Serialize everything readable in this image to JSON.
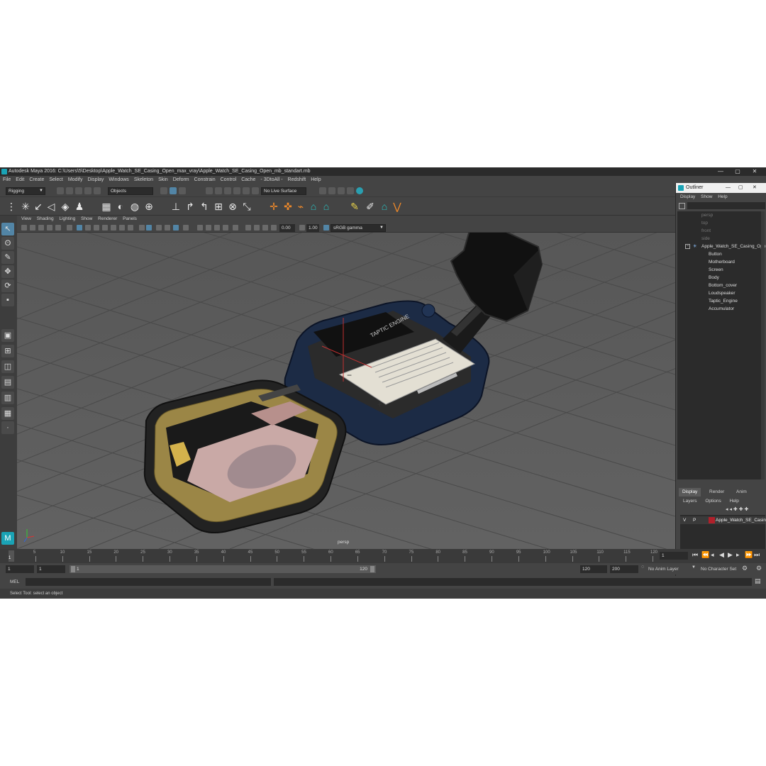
{
  "window": {
    "title": "Autodesk Maya 2016: C:\\Users\\5\\Desktop\\Apple_Watch_SE_Casing_Open_max_vray\\Apple_Watch_SE_Casing_Open_mb_standart.mb",
    "minimize": "—",
    "maximize": "▢",
    "close": "✕"
  },
  "menu": [
    "File",
    "Edit",
    "Create",
    "Select",
    "Modify",
    "Display",
    "Windows",
    "Skeleton",
    "Skin",
    "Deform",
    "Constrain",
    "Control",
    "Cache",
    "- 3DtoAll -",
    "Redshift",
    "Help"
  ],
  "status": {
    "mode": "Rigging",
    "selection_mode": "Objects",
    "live_surface": "No Live Surface"
  },
  "panel_menu": [
    "View",
    "Shading",
    "Lighting",
    "Show",
    "Renderer",
    "Panels"
  ],
  "panel_toolbar": {
    "exposure": "0.00",
    "gamma": "1.00",
    "color_space": "sRGB gamma"
  },
  "viewport": {
    "camera_label": "persp",
    "battery_label": "TAPTIC ENGINE",
    "battery_minus": "−",
    "battery_plus": "+"
  },
  "outliner": {
    "title": "Outliner",
    "menu": [
      "Display",
      "Show",
      "Help"
    ],
    "cameras": [
      "persp",
      "top",
      "front",
      "side"
    ],
    "root": "Apple_Watch_SE_Casing_Open",
    "children": [
      "Button",
      "Motherboard",
      "Screen",
      "Body",
      "Bottom_cover",
      "Loudspeaker",
      "Taptic_Engine",
      "Accumulator"
    ]
  },
  "channel_box": {
    "tabs": [
      "Display",
      "Render",
      "Anim"
    ],
    "layer_menu": [
      "Layers",
      "Options",
      "Help"
    ],
    "layer": {
      "v": "V",
      "p": "P",
      "name": "Apple_Watch_SE_Casing_Open",
      "color": "#b0202a"
    }
  },
  "timeline": {
    "ticks": [
      "5",
      "10",
      "15",
      "20",
      "25",
      "30",
      "35",
      "40",
      "45",
      "50",
      "55",
      "60",
      "65",
      "70",
      "75",
      "80",
      "85",
      "90",
      "95",
      "100",
      "105",
      "110",
      "115",
      "120"
    ],
    "current_frame": "1",
    "current_frame_field": "1"
  },
  "range": {
    "start": "1",
    "anim_start": "1",
    "range_start_label": "1",
    "range_end_label": "120",
    "end": "120",
    "anim_end": "200",
    "anim_layer": "No Anim Layer",
    "character_set": "No Character Set"
  },
  "command": {
    "label": "MEL"
  },
  "help_line": "Select Tool: select an object"
}
